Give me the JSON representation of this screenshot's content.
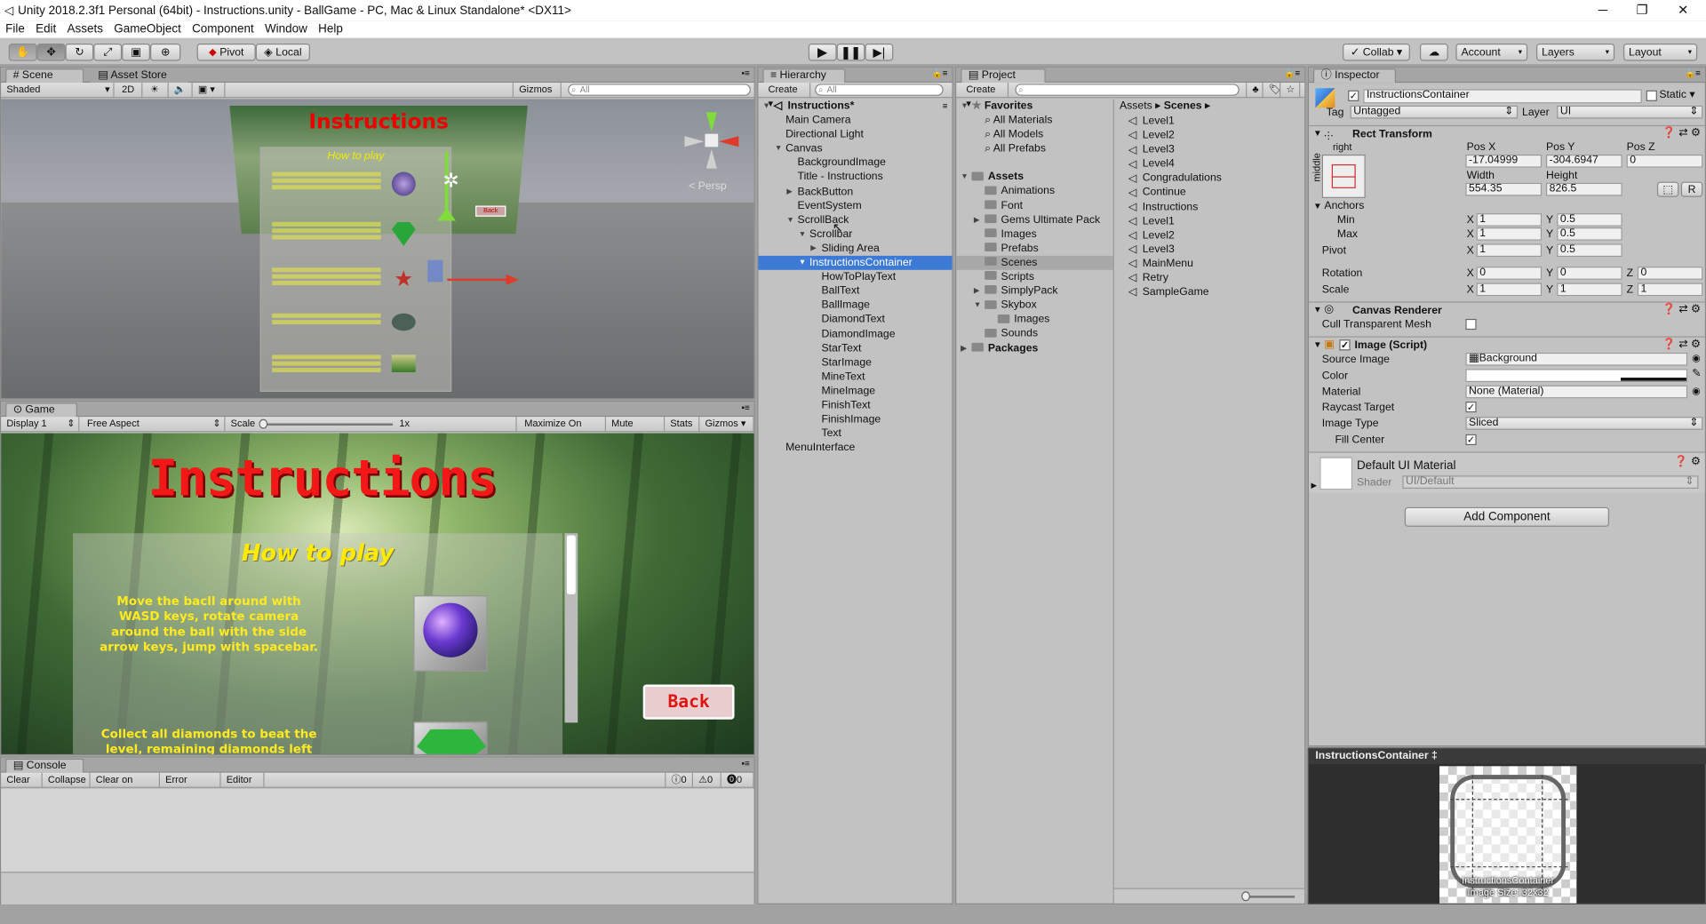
{
  "window": {
    "title": "Unity 2018.2.3f1 Personal (64bit) - Instructions.unity - BallGame - PC, Mac & Linux Standalone* <DX11>",
    "minimize": "─",
    "maximize": "❐",
    "close": "✕"
  },
  "menu": [
    "File",
    "Edit",
    "Assets",
    "GameObject",
    "Component",
    "Window",
    "Help"
  ],
  "toolbar": {
    "pivot": "Pivot",
    "local": "Local",
    "collab": "Collab ▾",
    "account": "Account",
    "layers": "Layers",
    "layout": "Layout"
  },
  "scene": {
    "tab_scene": "Scene",
    "tab_store": "Asset Store",
    "shading": "Shaded",
    "mode2d": "2D",
    "gizmos": "Gizmos ▾",
    "search": "All",
    "persp": "Persp",
    "sign_title": "Instructions",
    "sign_sub": "How to play",
    "sign_back": "Back"
  },
  "game": {
    "tab": "Game",
    "display": "Display 1",
    "aspect": "Free Aspect",
    "scale_label": "Scale",
    "scale_value": "1x",
    "maximize": "Maximize On Play",
    "mute": "Mute Audio",
    "stats": "Stats",
    "gizmos": "Gizmos ▾",
    "title": "Instructions",
    "subtitle": "How to play",
    "para1": "Move the bacll around with WASD keys, rotate camera around the ball with the side arrow keys, jump with spacebar.",
    "para2": "Collect all diamonds to beat the level, remaining diamonds left",
    "back": "Back"
  },
  "console": {
    "tab": "Console",
    "clear": "Clear",
    "collapse": "Collapse",
    "clear_on_play": "Clear on Play",
    "error_pause": "Error Pause",
    "editor": "Editor",
    "count_info": "0",
    "count_warn": "0",
    "count_err": "0"
  },
  "hierarchy": {
    "tab": "Hierarchy",
    "create": "Create",
    "search": "All",
    "items": [
      {
        "label": "Instructions*",
        "indent": 0
      },
      {
        "label": "Main Camera",
        "indent": 1
      },
      {
        "label": "Directional Light",
        "indent": 1
      },
      {
        "label": "Canvas",
        "indent": 1
      },
      {
        "label": "BackgroundImage",
        "indent": 2
      },
      {
        "label": "Title - Instructions",
        "indent": 2
      },
      {
        "label": "BackButton",
        "indent": 2
      },
      {
        "label": "EventSystem",
        "indent": 2
      },
      {
        "label": "ScrollBack",
        "indent": 2
      },
      {
        "label": "Scrollbar",
        "indent": 3
      },
      {
        "label": "Sliding Area",
        "indent": 4
      },
      {
        "label": "InstructionsContainer",
        "indent": 3
      },
      {
        "label": "HowToPlayText",
        "indent": 4
      },
      {
        "label": "BallText",
        "indent": 4
      },
      {
        "label": "BallImage",
        "indent": 4
      },
      {
        "label": "DiamondText",
        "indent": 4
      },
      {
        "label": "DiamondImage",
        "indent": 4
      },
      {
        "label": "StarText",
        "indent": 4
      },
      {
        "label": "StarImage",
        "indent": 4
      },
      {
        "label": "MineText",
        "indent": 4
      },
      {
        "label": "MineImage",
        "indent": 4
      },
      {
        "label": "FinishText",
        "indent": 4
      },
      {
        "label": "FinishImage",
        "indent": 4
      },
      {
        "label": "Text",
        "indent": 4
      },
      {
        "label": "MenuInterface",
        "indent": 1
      }
    ]
  },
  "project": {
    "tab": "Project",
    "create": "Create",
    "favorites_label": "Favorites",
    "favorites": [
      "All Materials",
      "All Models",
      "All Prefabs"
    ],
    "assets_label": "Assets",
    "folders": [
      "Animations",
      "Font",
      "Gems Ultimate Pack",
      "Images",
      "Prefabs",
      "Scenes",
      "Scripts",
      "SimplyPack",
      "Skybox",
      "Images",
      "Sounds"
    ],
    "packages_label": "Packages",
    "breadcrumb_root": "Assets",
    "breadcrumb_current": "Scenes",
    "scenes": [
      "Level1",
      "Level2",
      "Level3",
      "Level4",
      "Congradulations",
      "Continue",
      "Instructions",
      "Level1",
      "Level2",
      "Level3",
      "MainMenu",
      "Retry",
      "SampleGame"
    ]
  },
  "inspector": {
    "tab": "Inspector",
    "name": "InstructionsContainer",
    "static": "Static",
    "tag_label": "Tag",
    "tag": "Untagged",
    "layer_label": "Layer",
    "layer": "UI",
    "rect": {
      "header": "Rect Transform",
      "anchor_h": "right",
      "anchor_v": "middle",
      "pos_x_label": "Pos X",
      "pos_y_label": "Pos Y",
      "pos_z_label": "Pos Z",
      "pos_x": "-17.04999",
      "pos_y": "-304.6947",
      "pos_z": "0",
      "width_label": "Width",
      "height_label": "Height",
      "width": "554.35",
      "height": "826.5",
      "anchors": "Anchors",
      "min": "Min",
      "max": "Max",
      "pivot": "Pivot",
      "min_x": "1",
      "min_y": "0.5",
      "max_x": "1",
      "max_y": "0.5",
      "pivot_x": "1",
      "pivot_y": "0.5",
      "rotation": "Rotation",
      "scale": "Scale",
      "rot_x": "0",
      "rot_y": "0",
      "rot_z": "0",
      "scale_x": "1",
      "scale_y": "1",
      "scale_z": "1",
      "x": "X",
      "y": "Y",
      "z": "Z",
      "r": "R"
    },
    "canvas_renderer": {
      "header": "Canvas Renderer",
      "cull": "Cull Transparent Mesh"
    },
    "image": {
      "header": "Image (Script)",
      "source_label": "Source Image",
      "source": "Background",
      "color_label": "Color",
      "material_label": "Material",
      "material": "None (Material)",
      "raycast_label": "Raycast Target",
      "type_label": "Image Type",
      "type": "Sliced",
      "fill_label": "Fill Center"
    },
    "material": {
      "name": "Default UI Material",
      "shader_label": "Shader",
      "shader": "UI/Default"
    },
    "add_component": "Add Component",
    "preview": {
      "header": "InstructionsContainer ‡",
      "caption": "InstructionsContainer",
      "size": "Image Size: 32x32"
    }
  }
}
